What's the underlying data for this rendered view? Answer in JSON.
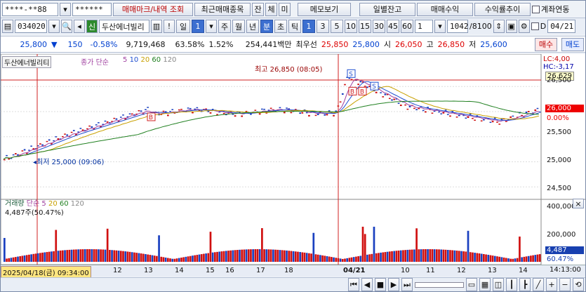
{
  "toolbar1": {
    "account": "****-**88",
    "password": "******",
    "tabs": [
      "매매마크/내역 조회",
      "최근매매종목",
      "잔",
      "체",
      "미",
      "메모보기",
      "일별잔고",
      "매매수익",
      "수익률추이"
    ],
    "checkbox_label": "계좌연동"
  },
  "toolbar2": {
    "code": "034020",
    "signal": "신",
    "name": "두산에너빌리",
    "excl": "!",
    "period": "일",
    "period_count": "1",
    "units": [
      "주",
      "월",
      "년",
      "분",
      "초",
      "틱"
    ],
    "active_unit": "분",
    "minutes": [
      "1",
      "3",
      "5",
      "10",
      "15",
      "30",
      "45",
      "60"
    ],
    "active_minute": "1",
    "count": "1",
    "range": "1042",
    "range_total": "/8100",
    "date_checkbox": "D",
    "date": "04/21"
  },
  "quote": {
    "price": "25,800",
    "change": "150",
    "change_pct": "-0.58%",
    "volume": "9,719,468",
    "ratio": "63.58%",
    "turnover": "1.52%",
    "amount": "254,441백만",
    "best_label": "최우선",
    "ask": "25,850",
    "bid": "25,800",
    "open_label": "시",
    "open": "26,050",
    "high_label": "고",
    "high": "26,850",
    "low_label": "저",
    "low": "25,600",
    "buy": "매수",
    "sell": "매도"
  },
  "price_panel": {
    "name": "두산에너빌리티",
    "legend_title": "종가",
    "legend_type": "단순",
    "ma": [
      "5",
      "10",
      "20",
      "60",
      "120"
    ],
    "high_note": "최고 26,850 (08:05)",
    "low_note": "최저 25,000 (09:06)",
    "lc": "LC:4,00",
    "hc": "HC:-3,17",
    "current_tag": "26,629",
    "price_tag": "26,000",
    "pct_tag": "0.00%",
    "y_ticks": [
      "26,500",
      "26,000",
      "25,500",
      "25,000",
      "24,500"
    ],
    "signal_labels": [
      "B",
      "S",
      "B",
      "B",
      "S"
    ]
  },
  "volume_panel": {
    "legend_title": "거래량",
    "legend_type": "단순",
    "ma": [
      "5",
      "20",
      "60",
      "120"
    ],
    "current": "4,487주(50.47%)",
    "y_ticks": [
      "400,000",
      "200,000"
    ],
    "vol_tag": "4,487",
    "vol_pct": "60.47%"
  },
  "xaxis": {
    "date_label": "2025/04/18(금) 09:34:00",
    "ticks": [
      "12",
      "13",
      "14",
      "15",
      "16",
      "17",
      "18",
      "04/21",
      "10",
      "11",
      "12",
      "13",
      "14"
    ],
    "time": "14:13:00"
  }
}
